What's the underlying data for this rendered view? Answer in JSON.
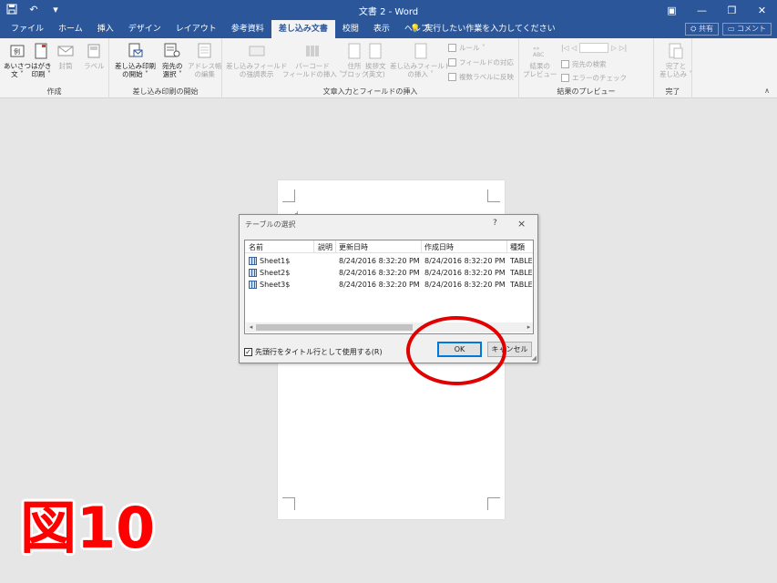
{
  "window": {
    "title": "文書 2  -  Word",
    "undo_icon": "undo-icon",
    "save_icon": "save-icon"
  },
  "menu": {
    "tabs": [
      "ファイル",
      "ホーム",
      "挿入",
      "デザイン",
      "レイアウト",
      "参考資料",
      "差し込み文書",
      "校閲",
      "表示",
      "ヘルプ"
    ],
    "active_tab": "差し込み文書",
    "tell_me": "実行したい作業を入力してください",
    "share": "共有",
    "comment": "コメント"
  },
  "ribbon": {
    "groups": {
      "create": "作成",
      "start_merge": "差し込み印刷の開始",
      "write_insert": "文章入力とフィールドの挿入",
      "preview": "結果のプレビュー",
      "finish": "完了"
    },
    "buttons": {
      "greeting_card": "あいさつ\n文 ˅",
      "postcard": "はがき\n印刷 ˅",
      "envelope": "封筒",
      "label": "ラベル",
      "start_mail_merge": "差し込み印刷\nの開始 ˅",
      "select_recipients": "宛先の\n選択 ˅",
      "edit_list": "アドレス帳\nの編集",
      "highlight_fields": "差し込みフィールド\nの強調表示",
      "barcode_field": "バーコード\nフィールドの挿入 ˅",
      "address_block": "住所\nブロック",
      "greeting_line": "挨拶文\n(英文)",
      "insert_merge_field": "差し込みフィールド\nの挿入 ˅",
      "rules": "ルール ˅",
      "match_fields": "フィールドの対応",
      "update_labels": "複数ラベルに反映",
      "preview_results": "結果の\nプレビュー",
      "find_recipient": "宛先の検索",
      "check_errors": "エラーのチェック",
      "finish_merge": "完了と\n差し込み ˅"
    }
  },
  "dialog": {
    "title": "テーブルの選択",
    "help": "?",
    "close": "×",
    "columns": [
      "名前",
      "説明",
      "更新日時",
      "作成日時",
      "種類"
    ],
    "rows": [
      {
        "name": "Sheet1$",
        "desc": "",
        "modified": "8/24/2016 8:32:20 PM",
        "created": "8/24/2016 8:32:20 PM",
        "type": "TABLE"
      },
      {
        "name": "Sheet2$",
        "desc": "",
        "modified": "8/24/2016 8:32:20 PM",
        "created": "8/24/2016 8:32:20 PM",
        "type": "TABLE"
      },
      {
        "name": "Sheet3$",
        "desc": "",
        "modified": "8/24/2016 8:32:20 PM",
        "created": "8/24/2016 8:32:20 PM",
        "type": "TABLE"
      }
    ],
    "first_row_header": "先頭行をタイトル行として使用する(R)",
    "first_row_header_checked": true,
    "ok": "OK",
    "cancel": "キャンセル"
  },
  "annotation": {
    "figure_label": "図10",
    "highlight_color": "#e00000"
  }
}
